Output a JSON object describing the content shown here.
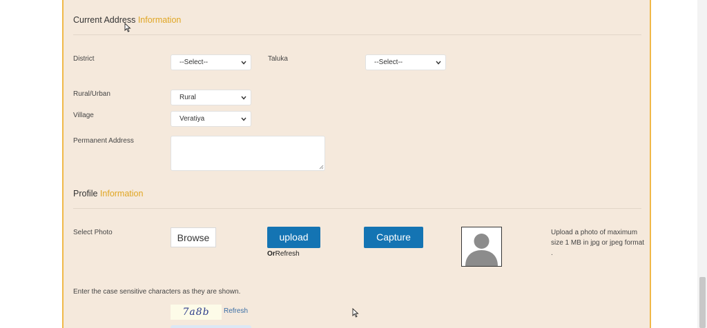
{
  "current_address": {
    "title_plain": "Current Address",
    "title_accent": "Information",
    "district": {
      "label": "District",
      "value": "--Select--"
    },
    "taluka": {
      "label": "Taluka",
      "value": "--Select--"
    },
    "rural_urban": {
      "label": "Rural/Urban",
      "value": "Rural"
    },
    "village": {
      "label": "Village",
      "value": "Veratiya"
    },
    "permanent_address": {
      "label": "Permanent Address",
      "value": ""
    }
  },
  "profile": {
    "title_plain": "Profile",
    "title_accent": "Information",
    "select_photo_label": "Select Photo",
    "browse_label": "Browse",
    "upload_label": "upload",
    "or_label": "Or",
    "refresh_label": "Refresh",
    "capture_label": "Capture",
    "photo_hint": "Upload a photo of maximum size 1 MB in jpg or jpeg format ."
  },
  "captcha": {
    "instruction": "Enter the case sensitive characters as they are shown.",
    "code": "7a8b",
    "refresh_label": "Refresh"
  },
  "colors": {
    "panel_bg": "#f5e9dc",
    "accent": "#e0a623",
    "button_blue": "#1474b3"
  }
}
